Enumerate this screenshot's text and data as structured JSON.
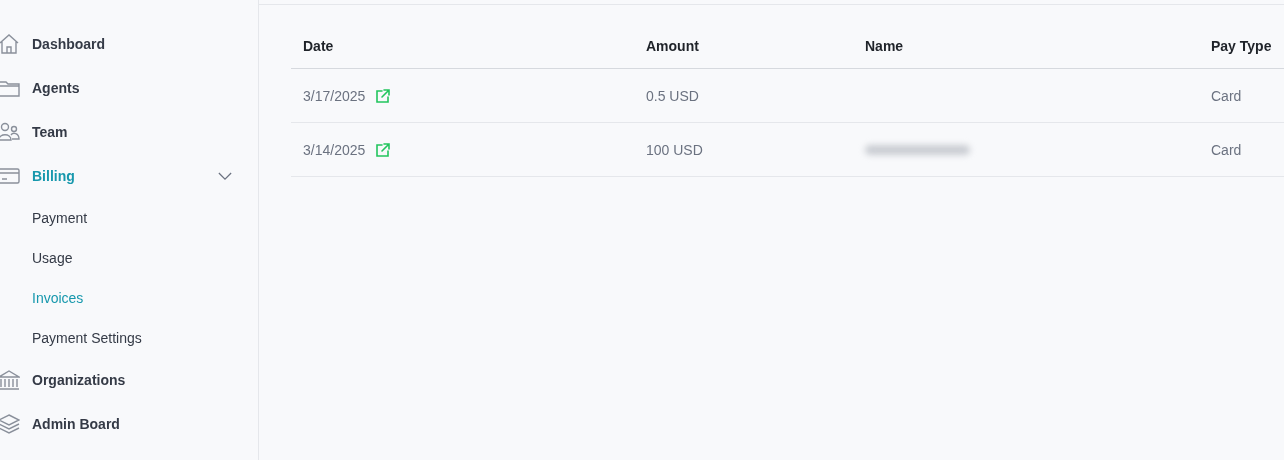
{
  "sidebar": {
    "items": [
      {
        "label": "Dashboard",
        "selected": false
      },
      {
        "label": "Agents",
        "selected": false
      },
      {
        "label": "Team",
        "selected": false
      },
      {
        "label": "Billing",
        "selected": true,
        "expanded": true,
        "children": [
          {
            "label": "Payment",
            "selected": false
          },
          {
            "label": "Usage",
            "selected": false
          },
          {
            "label": "Invoices",
            "selected": true
          },
          {
            "label": "Payment Settings",
            "selected": false
          }
        ]
      },
      {
        "label": "Organizations",
        "selected": false
      },
      {
        "label": "Admin Board",
        "selected": false
      }
    ]
  },
  "table": {
    "columns": [
      "Date",
      "Amount",
      "Name",
      "Pay Type"
    ],
    "rows": [
      {
        "date": "3/17/2025",
        "amount": "0.5 USD",
        "name_redacted": false,
        "pay_type": "Card"
      },
      {
        "date": "3/14/2025",
        "amount": "100 USD",
        "name_redacted": true,
        "pay_type": "Card"
      }
    ]
  }
}
